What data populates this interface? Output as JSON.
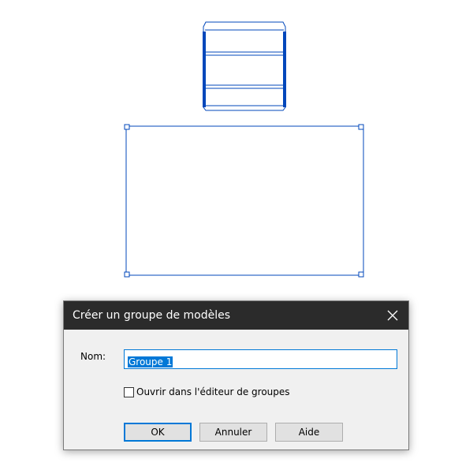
{
  "dialog": {
    "title": "Créer un groupe de modèles",
    "close_icon": "close-icon",
    "name_label": "Nom:",
    "name_value": "Groupe 1",
    "checkbox_label": "Ouvrir dans l'éditeur de groupes",
    "checkbox_checked": false,
    "ok_label": "OK",
    "cancel_label": "Annuler",
    "help_label": "Aide"
  },
  "colors": {
    "drawing_line": "#0047bb",
    "titlebar_bg": "#2b2b2b",
    "accent": "#0078d7",
    "dialog_bg": "#f0f0f0"
  }
}
